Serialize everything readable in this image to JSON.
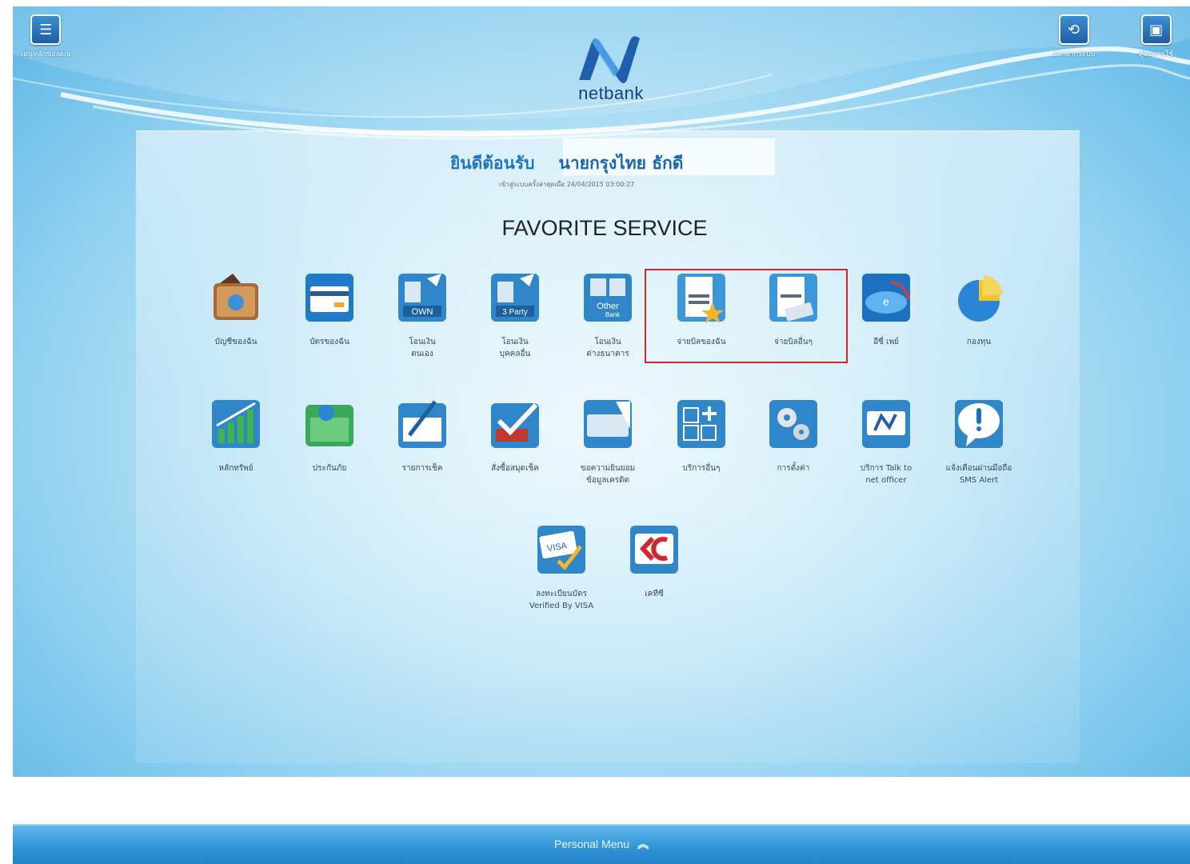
{
  "header": {
    "menu_label": "เมนูหลักของคุณ",
    "logout_label": "ออกจากระบบ",
    "manual_label": "คู่มือการใช้",
    "logo_text": "netbank"
  },
  "welcome": {
    "greeting": "ยินดีต้อนรับ",
    "user_name": "นายกรุงไทย  ธักดี",
    "last_login": "เข้าสู่ระบบครั้งล่าสุดเมื่อ 24/04/2015 03:00:27"
  },
  "favorite_title": "FAVORITE SERVICE",
  "services_row1": [
    {
      "label": "บัญชีของฉัน"
    },
    {
      "label": "บัตรของฉัน"
    },
    {
      "label": "โอนเงิน\nตนเอง"
    },
    {
      "label": "โอนเงิน\nบุคคลอื่น"
    },
    {
      "label": "โอนเงิน\nต่างธนาคาร"
    },
    {
      "label": "จ่ายบิลของฉัน"
    },
    {
      "label": "จ่ายบิลอื่นๆ"
    },
    {
      "label": "อีซี่ เพย์"
    },
    {
      "label": "กองทุน"
    }
  ],
  "services_row2": [
    {
      "label": "หลักทรัพย์"
    },
    {
      "label": "ประกันภัย"
    },
    {
      "label": "รายการเช็ค"
    },
    {
      "label": "สั่งซื้อสมุดเช็ค"
    },
    {
      "label": "ขอความยินยอม\nข้อมูลเครดิต"
    },
    {
      "label": "บริการอื่นๆ"
    },
    {
      "label": "การตั้งค่า"
    },
    {
      "label": "บริการ Talk to\nnet officer"
    },
    {
      "label": "แจ้งเตือนผ่านมือถือ\nSMS Alert"
    }
  ],
  "services_row3": [
    {
      "label": "ลงทะเบียนบัตร\nVerified By VISA"
    },
    {
      "label": "เคทีซี"
    }
  ],
  "footer": {
    "label": "Personal Menu",
    "chevron": "︽"
  },
  "colors": {
    "accent": "#1b74c4",
    "highlight": "#d3262b",
    "footer": "#2f93d6"
  }
}
